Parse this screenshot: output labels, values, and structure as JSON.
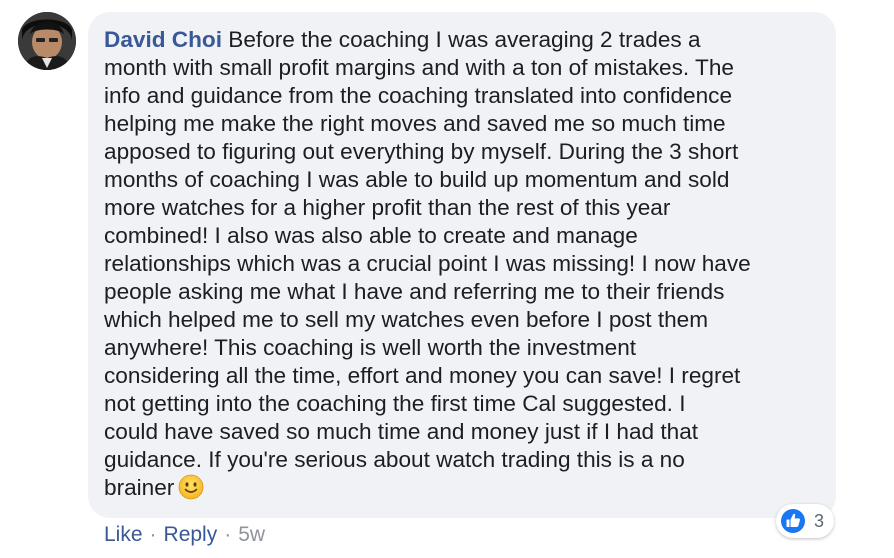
{
  "comment": {
    "author": "David Choi",
    "body": "Before the coaching I was averaging 2 trades a\nmonth with small profit margins and with a ton of mistakes. The\ninfo and guidance from the coaching translated into confidence\nhelping me make the right moves and saved me so much time\napposed to figuring out everything by myself. During the 3 short\nmonths of coaching I was able to build up momentum and sold\nmore watches for a higher profit than the rest of this year\ncombined! I also was also able to create and manage\nrelationships which was a crucial point I was missing! I now have\npeople asking me what I have and referring me to their friends\nwhich helped me to sell my watches even before I post them\nanywhere! This coaching is well worth the investment\nconsidering all the time, effort and money you can save! I regret\nnot getting into the coaching the first time Cal suggested. I\ncould have saved so much time and money just if I had that\nguidance. If you're serious about watch trading this is a no\nbrainer",
    "emoji_icon": "slightly-smiling-face-icon"
  },
  "reactions": {
    "icon": "like-icon",
    "count": "3"
  },
  "actions": {
    "like_label": "Like",
    "separator": "·",
    "reply_label": "Reply",
    "timestamp": "5w"
  },
  "colors": {
    "author_link": "#385898",
    "bubble_bg": "#f0f2f5",
    "text": "#1c1e21",
    "meta": "#90949c",
    "like_blue": "#1877f2"
  }
}
